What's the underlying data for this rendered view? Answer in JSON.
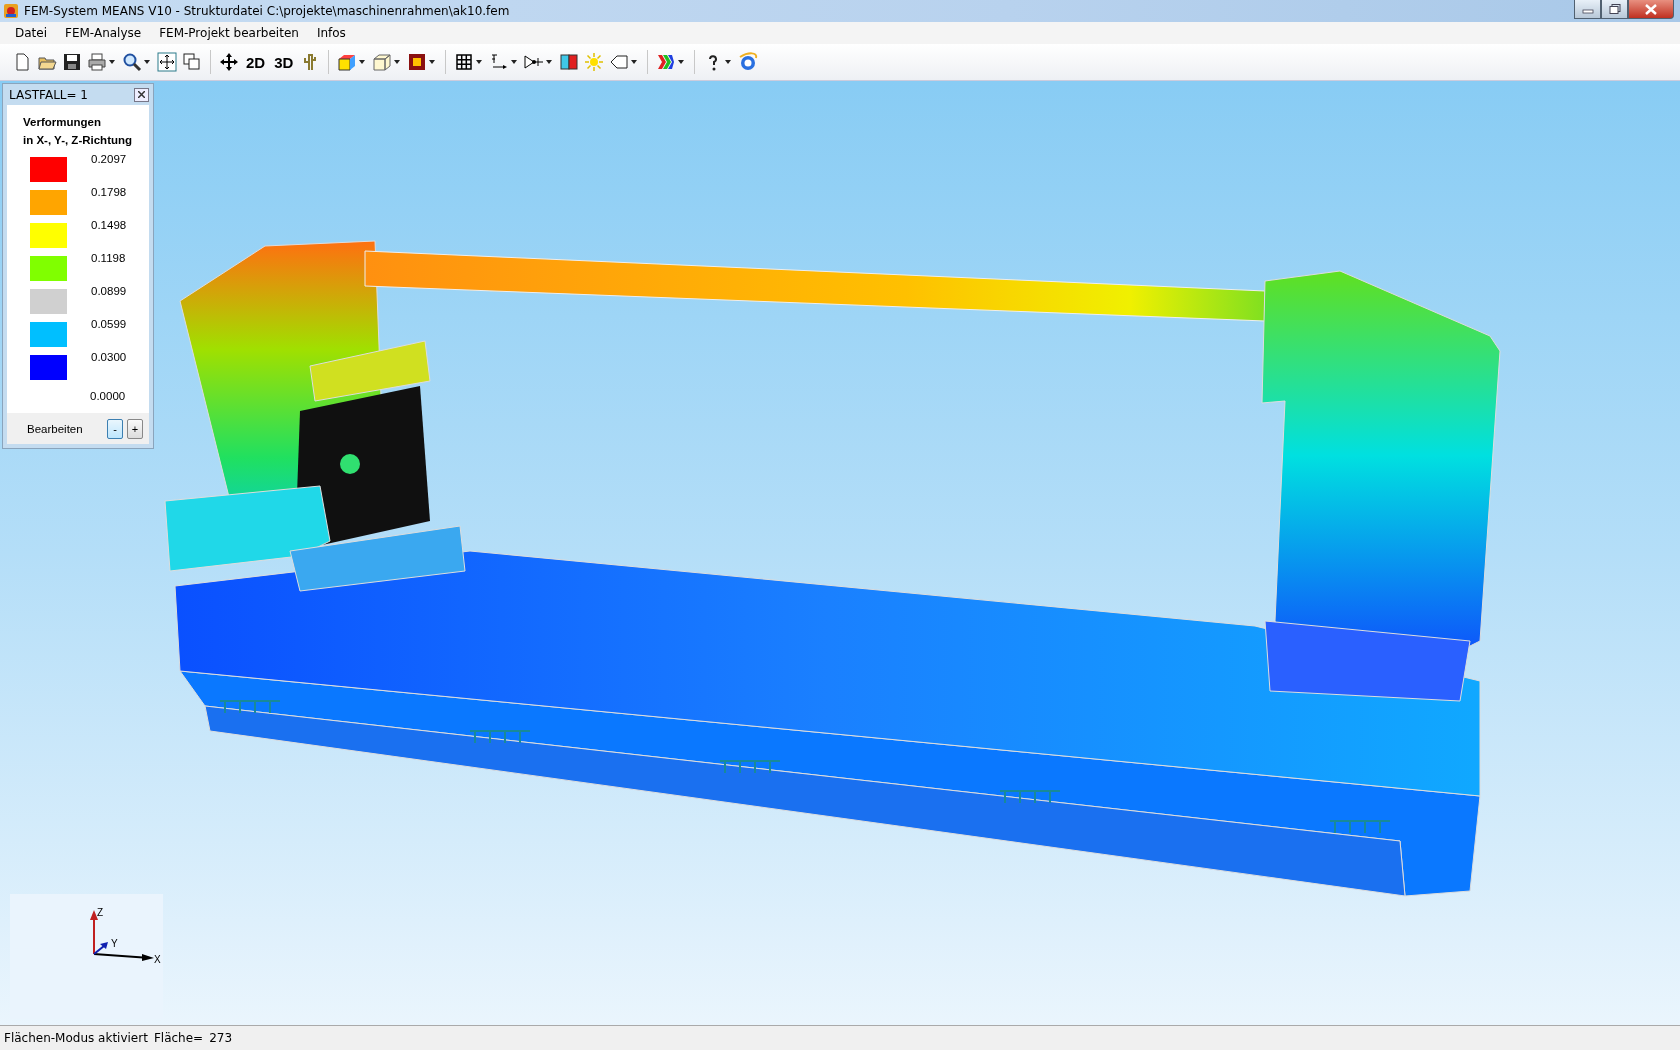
{
  "window": {
    "title": "FEM-System MEANS V10 - Strukturdatei C:\\projekte\\maschinenrahmen\\ak10.fem"
  },
  "menu": [
    "Datei",
    "FEM-Analyse",
    "FEM-Projekt bearbeiten",
    "Infos"
  ],
  "toolbar": {
    "view_2d": "2D",
    "view_3d": "3D"
  },
  "legend": {
    "title": "LASTFALL=  1",
    "heading": "Verformungen",
    "subheading": "in X-, Y-, Z-Richtung",
    "items": [
      {
        "value": "0.2097",
        "color": "#ff0000"
      },
      {
        "value": "0.1798",
        "color": "#ffa500"
      },
      {
        "value": "0.1498",
        "color": "#ffff00"
      },
      {
        "value": "0.1198",
        "color": "#80ff00"
      },
      {
        "value": "0.0899",
        "color": "#d0d0d0"
      },
      {
        "value": "0.0599",
        "color": "#00bfff"
      },
      {
        "value": "0.0300",
        "color": "#0000ff"
      }
    ],
    "last_value": "0.0000",
    "edit_label": "Bearbeiten",
    "minus": "-",
    "plus": "+"
  },
  "axes": {
    "x": "X",
    "y": "Y",
    "z": "Z"
  },
  "status_bar": {
    "mode": "Flächen-Modus aktiviert",
    "area_label": "Fläche=",
    "area_value": "273"
  }
}
